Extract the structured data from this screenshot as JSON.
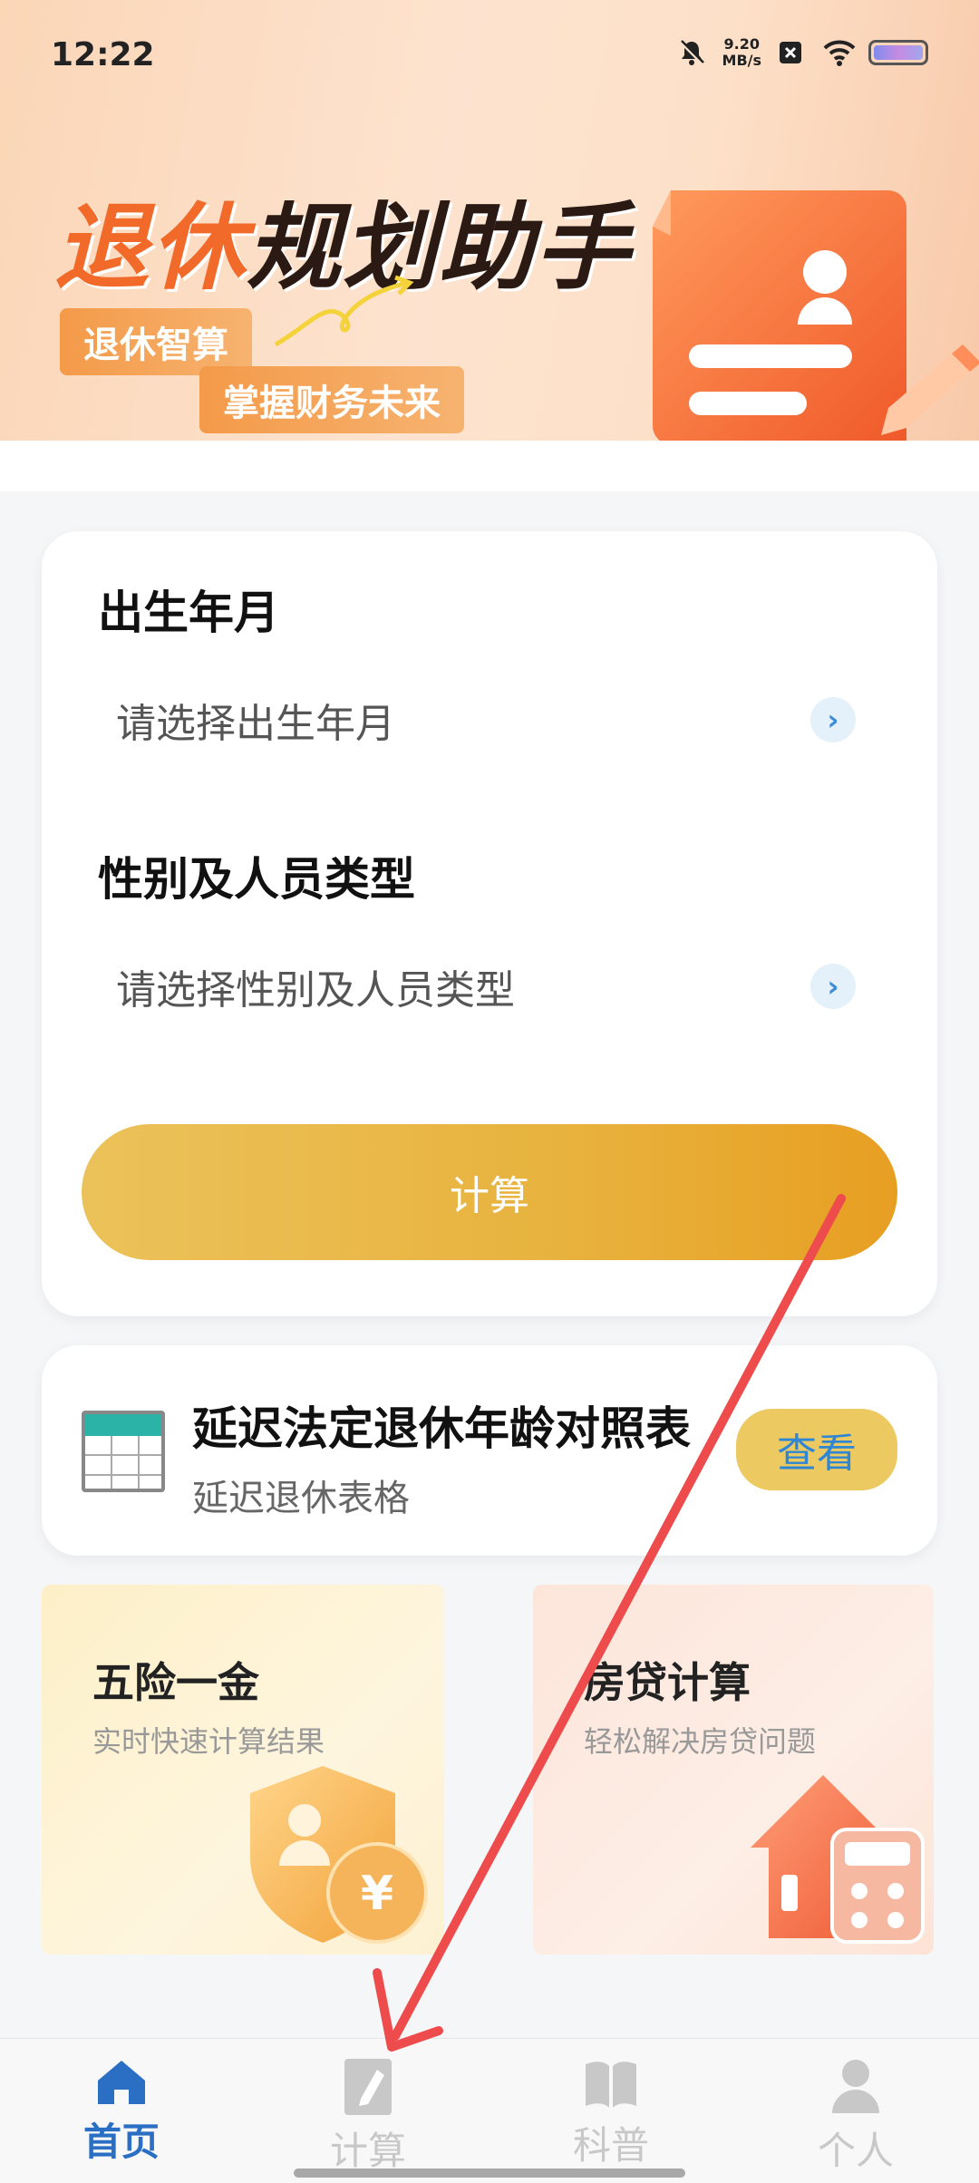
{
  "status_bar": {
    "time": "12:22",
    "speed_value": "9.20",
    "speed_unit": "MB/s",
    "icons": [
      "mute-bell-icon",
      "close-box-icon",
      "wifi-icon",
      "battery-icon"
    ]
  },
  "banner": {
    "title_part1": "退休",
    "title_part2": "规划助手",
    "tag1": "退休智算",
    "tag2": "掌握财务未来"
  },
  "form": {
    "birth_label": "出生年月",
    "birth_placeholder": "请选择出生年月",
    "gender_label": "性别及人员类型",
    "gender_placeholder": "请选择性别及人员类型",
    "calculate_label": "计算"
  },
  "table_card": {
    "title": "延迟法定退休年龄对照表",
    "subtitle": "延迟退休表格",
    "view_label": "查看"
  },
  "tiles": [
    {
      "title": "五险一金",
      "subtitle": "实时快速计算结果",
      "icon": "shield-yuan-icon"
    },
    {
      "title": "房贷计算",
      "subtitle": "轻松解决房贷问题",
      "icon": "house-calculator-icon"
    }
  ],
  "bottom_nav": [
    {
      "label": "首页",
      "icon": "home-icon",
      "active": true
    },
    {
      "label": "计算",
      "icon": "calculate-icon",
      "active": false
    },
    {
      "label": "科普",
      "icon": "book-icon",
      "active": false
    },
    {
      "label": "个人",
      "icon": "person-icon",
      "active": false
    }
  ],
  "colors": {
    "accent_orange": "#f26a2a",
    "button_gold": "#e8b23d",
    "nav_active": "#2a6fc3",
    "link_blue": "#2e86d4",
    "annotation_arrow": "#ee4c4c"
  }
}
